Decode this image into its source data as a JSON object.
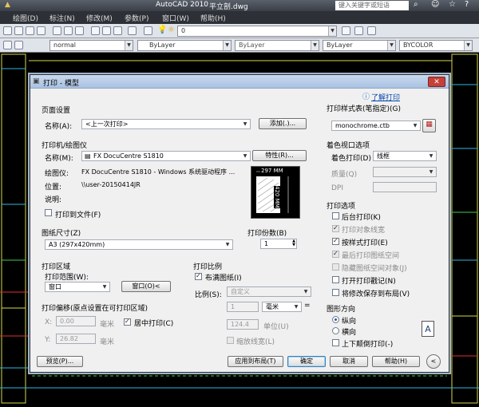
{
  "cad": {
    "app_title": "AutoCAD 2010",
    "doc_title": "平立剖.dwg",
    "search_placeholder": "键入关键字或短语",
    "menu": [
      "绘图(D)",
      "标注(N)",
      "修改(M)",
      "参数(P)",
      "窗口(W)",
      "帮助(H)"
    ],
    "layer_value": "0",
    "style_value": "normal",
    "color_value": "ByLayer",
    "linetype_value": "ByLayer",
    "lineweight_value": "ByLayer",
    "plotstyle_value": "BYCOLOR"
  },
  "dialog": {
    "title": "打印 - 模型",
    "close": "✕",
    "help_link": "了解打印",
    "page_setup": {
      "section": "页面设置",
      "name_label": "名称(A):",
      "name_value": "<上一次打印>",
      "add_button": "添加(.)..."
    },
    "printer": {
      "section": "打印机/绘图仪",
      "name_label": "名称(M):",
      "name_value": "FX DocuCentre S1810",
      "properties_button": "特性(R)...",
      "plotter_label": "绘图仪:",
      "plotter_value": "FX DocuCentre S1810 - Windows 系统驱动程序 ...",
      "location_label": "位置:",
      "location_value": "\\\\user-20150414JR",
      "description_label": "说明:",
      "print_to_file": "打印到文件(F)",
      "preview_width": "297 MM",
      "preview_height": "420 MM"
    },
    "paper_size": {
      "section": "图纸尺寸(Z)",
      "value": "A3 (297x420mm)"
    },
    "copies": {
      "section": "打印份数(B)",
      "value": "1"
    },
    "plot_area": {
      "section": "打印区域",
      "range_label": "打印范围(W):",
      "range_value": "窗口",
      "window_button": "窗口(O)<"
    },
    "plot_offset": {
      "section": "打印偏移(原点设置在可打印区域)",
      "x_label": "X:",
      "x_value": "0.00",
      "x_unit": "毫米",
      "center_plot": "居中打印(C)",
      "y_label": "Y:",
      "y_value": "26.82",
      "y_unit": "毫米"
    },
    "plot_scale": {
      "section": "打印比例",
      "fit_paper": "布满图纸(I)",
      "scale_label": "比例(S):",
      "scale_value": "自定义",
      "value1": "1",
      "unit_value": "毫米",
      "equals": "=",
      "value2": "124.4",
      "unit_label": "单位(U)",
      "scale_lineweights": "缩放线宽(L)"
    },
    "plot_style_table": {
      "section": "打印样式表(笔指定)(G)",
      "value": "monochrome.ctb"
    },
    "shaded_viewport": {
      "section": "着色视口选项",
      "shade_label": "着色打印(D)",
      "shade_value": "线框",
      "quality_label": "质量(Q)",
      "dpi_label": "DPI"
    },
    "plot_options": {
      "section": "打印选项",
      "items": [
        {
          "label": "后台打印(K)",
          "checked": false,
          "disabled": false
        },
        {
          "label": "打印对象线宽",
          "checked": true,
          "disabled": true
        },
        {
          "label": "按样式打印(E)",
          "checked": true,
          "disabled": false
        },
        {
          "label": "最后打印图纸空间",
          "checked": true,
          "disabled": true
        },
        {
          "label": "隐藏图纸空间对象(J)",
          "checked": false,
          "disabled": true
        },
        {
          "label": "打开打印戳记(N)",
          "checked": false,
          "disabled": false
        },
        {
          "label": "将修改保存到布局(V)",
          "checked": false,
          "disabled": false
        }
      ]
    },
    "orientation": {
      "section": "图形方向",
      "portrait": "纵向",
      "landscape": "横向",
      "upside_down": "上下颠倒打印(-)",
      "icon_letter": "A"
    },
    "footer": {
      "preview": "预览(P)...",
      "apply_layout": "应用到布局(T)",
      "ok": "确定",
      "cancel": "取消",
      "help": "帮助(H)",
      "collapse": "<"
    }
  }
}
